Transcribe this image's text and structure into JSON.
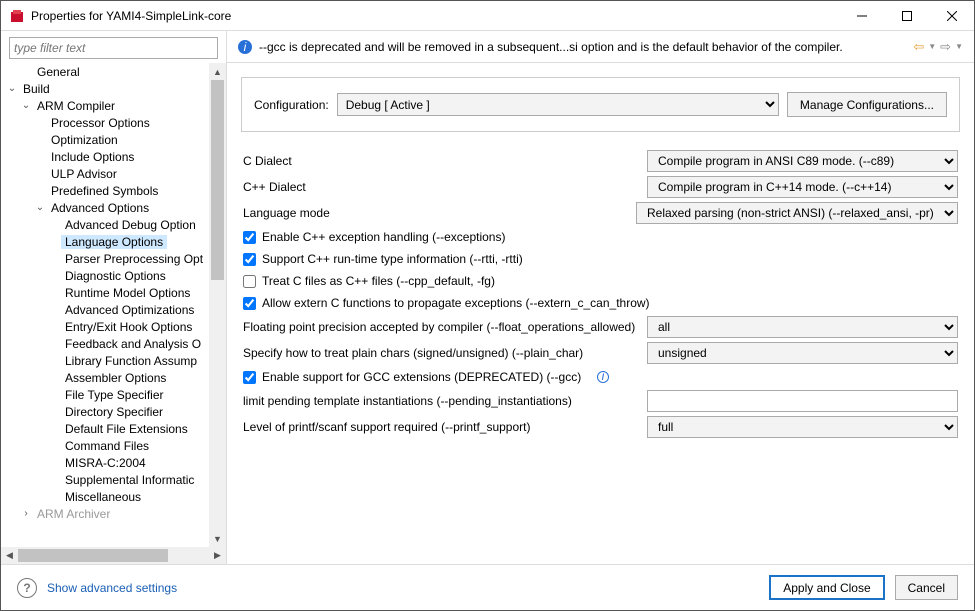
{
  "titlebar": {
    "title": "Properties for YAMI4-SimpleLink-core"
  },
  "filter": {
    "placeholder": "type filter text"
  },
  "tree": {
    "general": "General",
    "build": "Build",
    "arm_compiler": "ARM Compiler",
    "processor_options": "Processor Options",
    "optimization": "Optimization",
    "include_options": "Include Options",
    "ulp_advisor": "ULP Advisor",
    "predefined_symbols": "Predefined Symbols",
    "advanced_options": "Advanced Options",
    "advanced_debug": "Advanced Debug Option",
    "language_options": "Language Options",
    "parser_pp": "Parser Preprocessing Opt",
    "diagnostic": "Diagnostic Options",
    "runtime_model": "Runtime Model Options",
    "advanced_opt": "Advanced Optimizations",
    "entry_exit": "Entry/Exit Hook Options",
    "feedback": "Feedback and Analysis O",
    "libfunc": "Library Function Assump",
    "assembler": "Assembler Options",
    "filetype": "File Type Specifier",
    "directory": "Directory Specifier",
    "default_ext": "Default File Extensions",
    "cmd_files": "Command Files",
    "misra": "MISRA-C:2004",
    "supplemental": "Supplemental Informatic",
    "misc": "Miscellaneous",
    "arm_archiver": "ARM Archiver"
  },
  "banner": {
    "message": "--gcc is deprecated and will be removed in a subsequent...si option and is the default behavior of the compiler."
  },
  "config": {
    "label": "Configuration:",
    "selected": "Debug  [ Active ]",
    "manage": "Manage Configurations..."
  },
  "form": {
    "c_dialect_label": "C Dialect",
    "c_dialect_value": "Compile program in ANSI C89 mode. (--c89)",
    "cpp_dialect_label": "C++ Dialect",
    "cpp_dialect_value": "Compile program in C++14 mode. (--c++14)",
    "lang_mode_label": "Language mode",
    "lang_mode_value": "Relaxed parsing (non-strict ANSI) (--relaxed_ansi, -pr)",
    "chk_exceptions": "Enable C++ exception handling (--exceptions)",
    "chk_rtti": "Support C++ run-time type information (--rtti, -rtti)",
    "chk_cpp_default": "Treat C files as C++ files (--cpp_default, -fg)",
    "chk_extern_c": "Allow extern C functions to propagate exceptions (--extern_c_can_throw)",
    "float_label": "Floating point precision accepted by compiler (--float_operations_allowed)",
    "float_value": "all",
    "plain_char_label": "Specify how to treat plain chars (signed/unsigned) (--plain_char)",
    "plain_char_value": "unsigned",
    "chk_gcc": "Enable support for GCC extensions (DEPRECATED) (--gcc)",
    "pending_label": "limit pending template instantiations (--pending_instantiations)",
    "pending_value": "",
    "printf_label": "Level of printf/scanf support required (--printf_support)",
    "printf_value": "full"
  },
  "footer": {
    "advanced_link": "Show advanced settings",
    "apply": "Apply and Close",
    "cancel": "Cancel"
  }
}
